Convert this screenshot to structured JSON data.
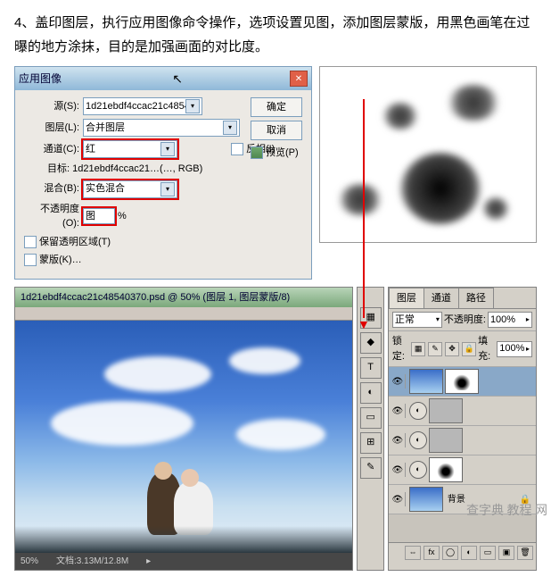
{
  "instruction": "4、盖印图层，执行应用图像命令操作，选项设置见图，添加图层蒙版，用黑色画笔在过曝的地方涂抹，目的是加强画面的对比度。",
  "dialog": {
    "title": "应用图像",
    "source_label": "源(S):",
    "source_value": "1d21ebdf4ccac21c4854…",
    "layer_label": "图层(L):",
    "layer_value": "合并图层",
    "channel_label": "通道(C):",
    "channel_value": "红",
    "invert_label": "反相(I)",
    "target_label": "目标:",
    "target_value": "1d21ebdf4ccac21…(…, RGB)",
    "blend_label": "混合(B):",
    "blend_value": "实色混合",
    "opacity_label": "不透明度(O):",
    "opacity_value": "图",
    "opacity_unit": "%",
    "preserve_label": "保留透明区域(T)",
    "mask_label": "蒙版(K)…",
    "ok": "确定",
    "cancel": "取消",
    "preview": "预览(P)"
  },
  "doc": {
    "title": "1d21ebdf4ccac21c48540370.psd @ 50% (图层 1, 图层蒙版/8)",
    "status_zoom": "50%",
    "status_size": "文档:3.13M/12.8M"
  },
  "layers": {
    "tab1": "图层",
    "tab2": "通道",
    "tab3": "路径",
    "mode_label": "正常",
    "opacity_label": "不透明度:",
    "opacity_value": "100%",
    "lock_label": "锁定:",
    "fill_label": "填充:",
    "fill_value": "100%",
    "items": [
      {
        "name": ""
      },
      {
        "name": ""
      },
      {
        "name": ""
      },
      {
        "name": ""
      },
      {
        "name": "背景"
      }
    ]
  },
  "watermark": "查字典 教程 网"
}
